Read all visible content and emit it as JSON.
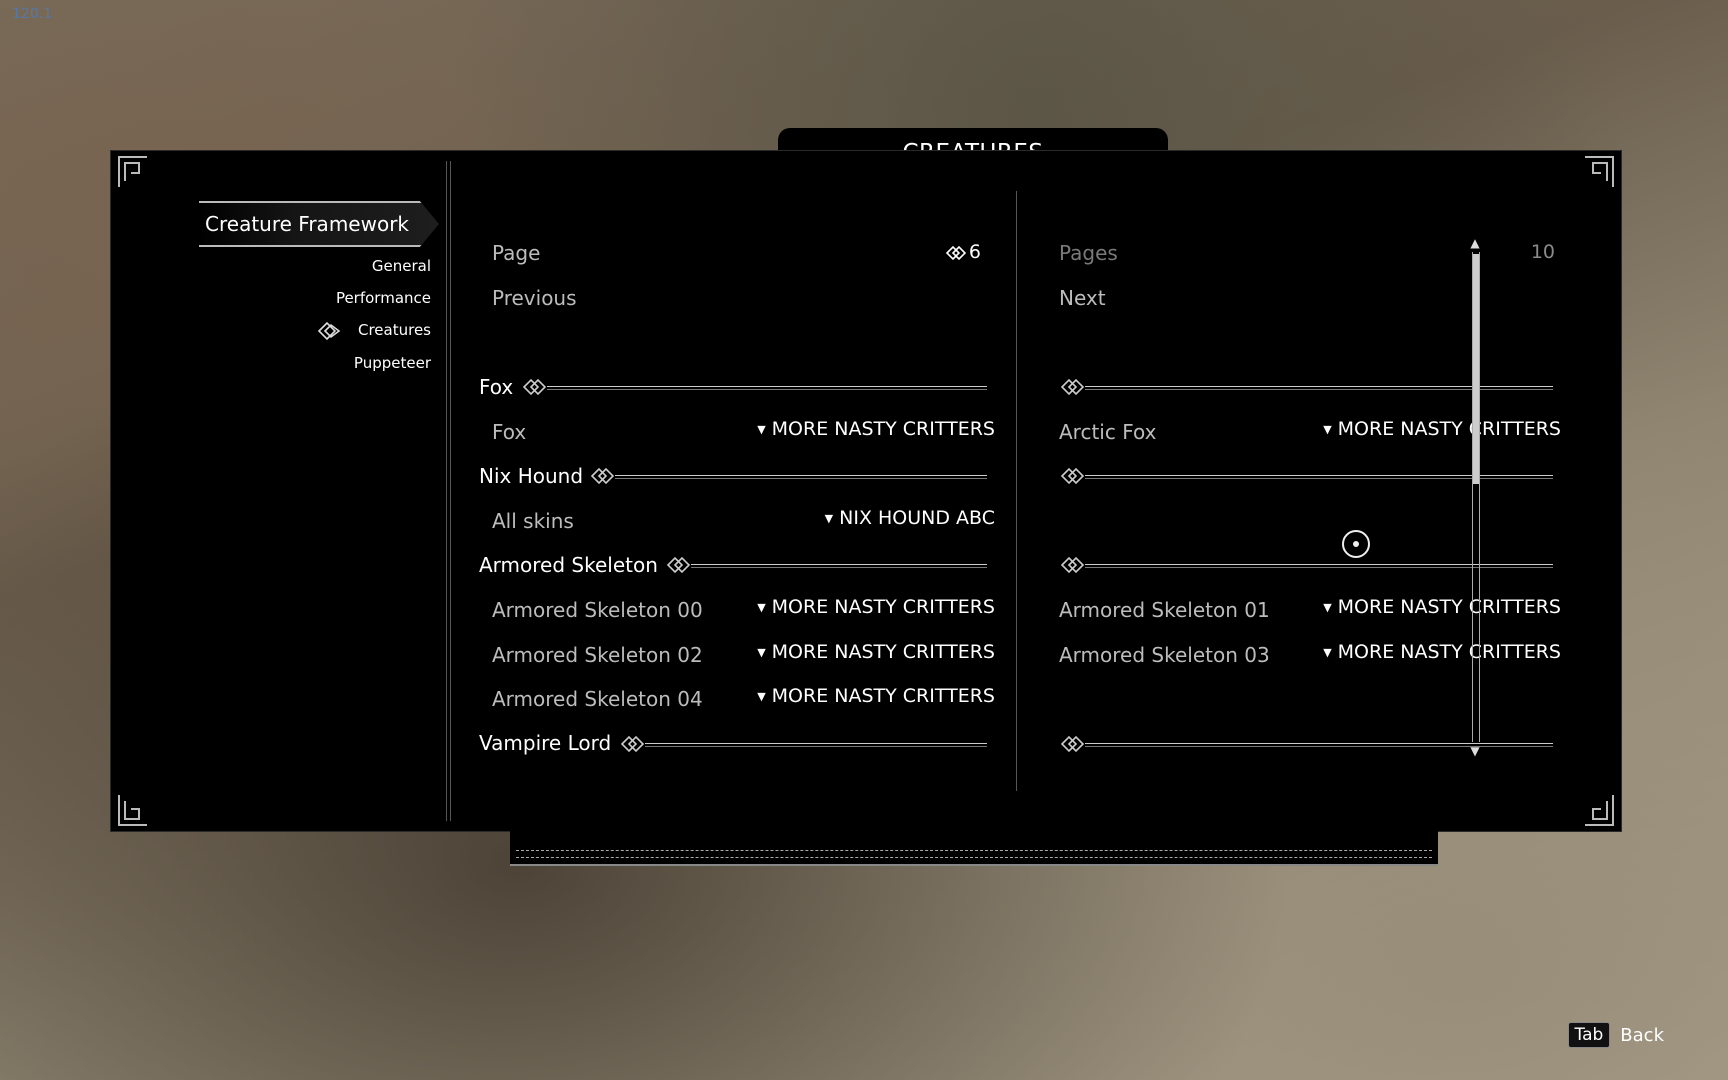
{
  "overlay": {
    "fps_text": "120.1"
  },
  "panel": {
    "title": "CREATURES"
  },
  "nav": {
    "active_mod": "Creature Framework",
    "items": [
      {
        "label": "General"
      },
      {
        "label": "Performance"
      },
      {
        "label": "Creatures",
        "selected": true
      },
      {
        "label": "Puppeteer"
      }
    ]
  },
  "left": {
    "page_label": "Page",
    "page_value": "6",
    "previous_label": "Previous"
  },
  "right": {
    "pages_label": "Pages",
    "pages_value": "10",
    "next_label": "Next"
  },
  "sections": [
    {
      "header": "Fox",
      "left": {
        "label": "Fox",
        "value": "MORE NASTY CRITTERS"
      },
      "right": {
        "label": "Arctic Fox",
        "value": "MORE NASTY CRITTERS"
      }
    },
    {
      "header": "Nix Hound",
      "left": {
        "label": "All skins",
        "value": "NIX HOUND ABC"
      }
    },
    {
      "header": "Armored Skeleton",
      "rows": [
        {
          "left": {
            "label": "Armored Skeleton 00",
            "value": "MORE NASTY CRITTERS"
          },
          "right": {
            "label": "Armored Skeleton 01",
            "value": "MORE NASTY CRITTERS"
          }
        },
        {
          "left": {
            "label": "Armored Skeleton 02",
            "value": "MORE NASTY CRITTERS"
          },
          "right": {
            "label": "Armored Skeleton 03",
            "value": "MORE NASTY CRITTERS"
          }
        },
        {
          "left": {
            "label": "Armored Skeleton 04",
            "value": "MORE NASTY CRITTERS"
          }
        }
      ]
    },
    {
      "header": "Vampire Lord"
    }
  ],
  "footer": {
    "key": "Tab",
    "action": "Back"
  }
}
